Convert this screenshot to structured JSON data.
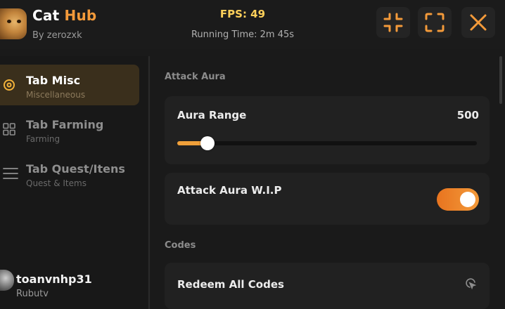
{
  "header": {
    "title_part1": "Cat",
    "title_part2": "Hub",
    "author": "By zerozxk",
    "fps": "FPS: 49",
    "running_time": "Running Time: 2m 45s",
    "accent_color": "#f39a3a"
  },
  "sidebar": {
    "tabs": [
      {
        "label": "Tab Misc",
        "subtitle": "Miscellaneous",
        "icon": "gear-icon",
        "active": true
      },
      {
        "label": "Tab Farming",
        "subtitle": "Farming",
        "icon": "grid-icon",
        "active": false
      },
      {
        "label": "Tab Quest/Itens",
        "subtitle": "Quest & Items",
        "icon": "menu-icon",
        "active": false
      }
    ],
    "user": {
      "name": "toanvnhp31",
      "sub": "Rubutv"
    }
  },
  "content": {
    "section_attack": "Attack Aura",
    "aura_range": {
      "label": "Aura Range",
      "value": "500",
      "fill_fraction": 0.1
    },
    "attack_aura_toggle": {
      "label": "Attack Aura W.I.P",
      "on": true
    },
    "section_codes": "Codes",
    "redeem": {
      "label": "Redeem All Codes",
      "icon": "tap-icon"
    }
  }
}
